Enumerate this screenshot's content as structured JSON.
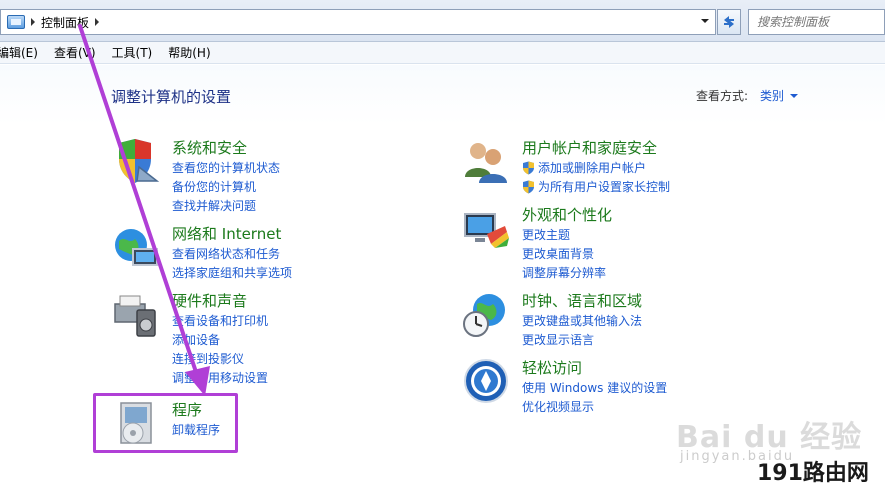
{
  "address": {
    "breadcrumb": "控制面板",
    "search_placeholder": "搜索控制面板"
  },
  "menu": [
    "编辑(E)",
    "查看(V)",
    "工具(T)",
    "帮助(H)"
  ],
  "page_title": "调整计算机的设置",
  "view_by": {
    "label": "查看方式:",
    "value": "类别"
  },
  "categories": [
    {
      "title": "系统和安全",
      "links": [
        "查看您的计算机状态",
        "备份您的计算机",
        "查找并解决问题"
      ]
    },
    {
      "title": "网络和 Internet",
      "links": [
        "查看网络状态和任务",
        "选择家庭组和共享选项"
      ]
    },
    {
      "title": "硬件和声音",
      "links": [
        "查看设备和打印机",
        "添加设备",
        "连接到投影仪",
        "调整常用移动设置"
      ]
    },
    {
      "title": "程序",
      "links": [
        "卸载程序"
      ]
    },
    {
      "title": "用户帐户和家庭安全",
      "links": [
        "添加或删除用户帐户",
        "为所有用户设置家长控制"
      ]
    },
    {
      "title": "外观和个性化",
      "links": [
        "更改主题",
        "更改桌面背景",
        "调整屏幕分辨率"
      ]
    },
    {
      "title": "时钟、语言和区域",
      "links": [
        "更改键盘或其他输入法",
        "更改显示语言"
      ]
    },
    {
      "title": "轻松访问",
      "links": [
        "使用 Windows 建议的设置",
        "优化视频显示"
      ]
    }
  ],
  "watermark": {
    "main": "Bai du 经验",
    "sub": "jingyan.baidu",
    "site": "191路由网"
  },
  "colors": {
    "link": "#1e5bd1",
    "category_title": "#1c7a1c",
    "annotation": "#b03fd6"
  }
}
